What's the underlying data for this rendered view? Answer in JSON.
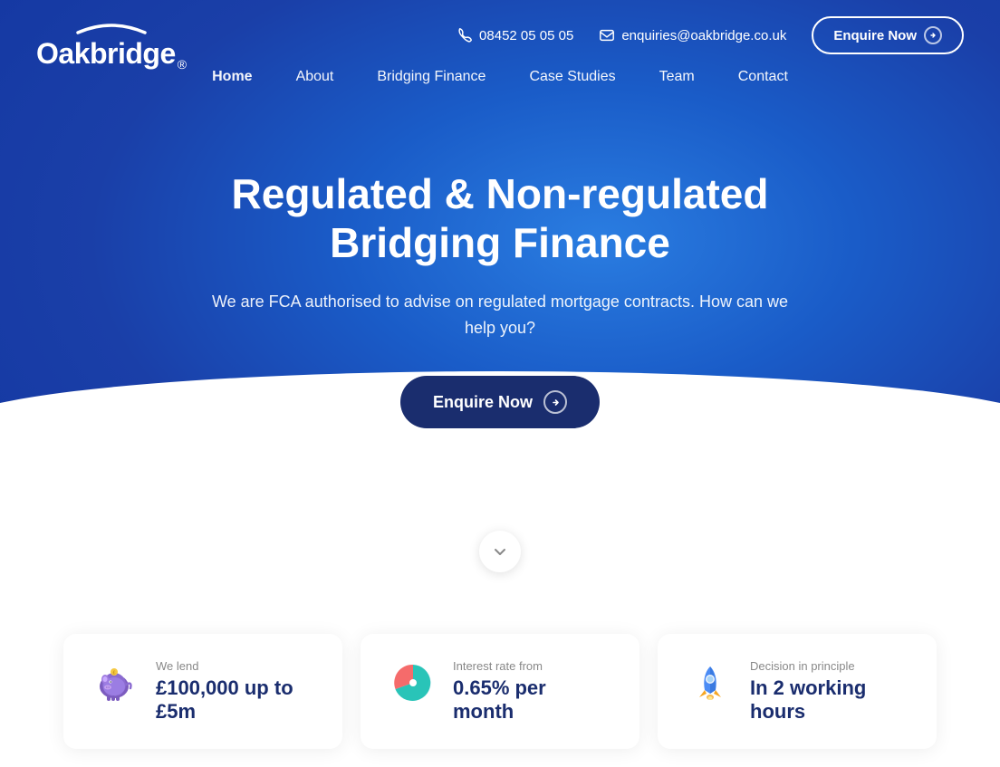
{
  "logo": {
    "name": "Oakbridge",
    "registered_symbol": "®"
  },
  "header": {
    "phone": "08452 05 05 05",
    "email": "enquiries@oakbridge.co.uk",
    "enquire_button": "Enquire Now"
  },
  "nav": {
    "items": [
      {
        "label": "Home",
        "active": true
      },
      {
        "label": "About",
        "active": false
      },
      {
        "label": "Bridging Finance",
        "active": false
      },
      {
        "label": "Case Studies",
        "active": false
      },
      {
        "label": "Team",
        "active": false
      },
      {
        "label": "Contact",
        "active": false
      }
    ]
  },
  "hero": {
    "title_line1": "Regulated & Non-regulated",
    "title_line2": "Bridging Finance",
    "subtitle": "We are FCA authorised to advise on regulated mortgage contracts. How can we help you?",
    "cta_button": "Enquire Now"
  },
  "stats": [
    {
      "label": "We lend",
      "value": "£100,000 up to £5m",
      "icon_name": "piggy-bank-icon"
    },
    {
      "label": "Interest rate from",
      "value": "0.65% per month",
      "icon_name": "pie-chart-icon"
    },
    {
      "label": "Decision in principle",
      "value": "In 2 working hours",
      "icon_name": "rocket-icon"
    }
  ],
  "colors": {
    "hero_bg_start": "#2a7de1",
    "hero_bg_end": "#1235a0",
    "cta_dark": "#1a2d6e",
    "text_blue": "#1a2d6e",
    "text_gray": "#888888",
    "white": "#ffffff"
  }
}
